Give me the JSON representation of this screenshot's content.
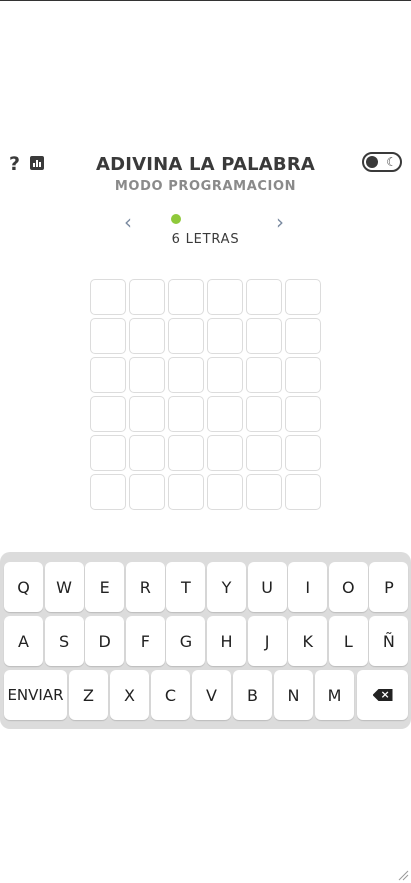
{
  "header": {
    "help_label": "?",
    "title": "ADIVINA LA PALABRA",
    "subtitle": "MODO PROGRAMACION",
    "theme_toggle_icon": "moon-icon"
  },
  "nav": {
    "prev_glyph": "‹",
    "next_glyph": "›",
    "letters_label": "6 LETRAS",
    "active_dot_color": "#8fc93a"
  },
  "board": {
    "rows": 6,
    "cols": 6
  },
  "keyboard": {
    "row1": [
      "Q",
      "W",
      "E",
      "R",
      "T",
      "Y",
      "U",
      "I",
      "O",
      "P"
    ],
    "row2": [
      "A",
      "S",
      "D",
      "F",
      "G",
      "H",
      "J",
      "K",
      "L",
      "Ñ"
    ],
    "row3": [
      "ENVIAR",
      "Z",
      "X",
      "C",
      "V",
      "B",
      "N",
      "M"
    ],
    "backspace_icon": "backspace-icon"
  }
}
